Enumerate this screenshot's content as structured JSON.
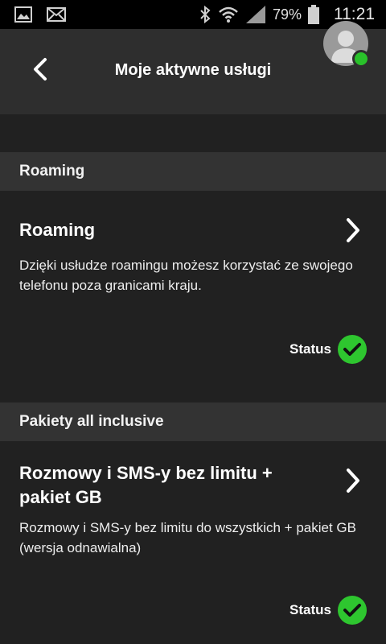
{
  "status_bar": {
    "battery_percent": "79%",
    "time": "11:21",
    "icons": [
      "gallery-icon",
      "mail-icon",
      "bluetooth-icon",
      "wifi-icon",
      "signal-icon",
      "battery-icon"
    ]
  },
  "header": {
    "title": "Moje aktywne usługi",
    "back_icon": "chevron-left-icon",
    "avatar_icon": "user-avatar-icon",
    "online_color": "#29c12a"
  },
  "sections": [
    {
      "header": "Roaming",
      "card": {
        "title": "Roaming",
        "description": "Dzięki usłudze roamingu możesz korzystać ze swojego telefonu poza granicami kraju.",
        "status_label": "Status",
        "status_active": true
      }
    },
    {
      "header": "Pakiety all inclusive",
      "card": {
        "title": "Rozmowy i SMS-y bez limitu + pakiet GB",
        "description": "Rozmowy i SMS-y bez limitu do wszystkich + pakiet GB (wersja odnawialna)",
        "status_label": "Status",
        "status_active": true
      }
    }
  ],
  "colors": {
    "background": "#212121",
    "header_bg": "#2e2e2e",
    "section_bg": "#333333",
    "status_green": "#2ec62f"
  }
}
